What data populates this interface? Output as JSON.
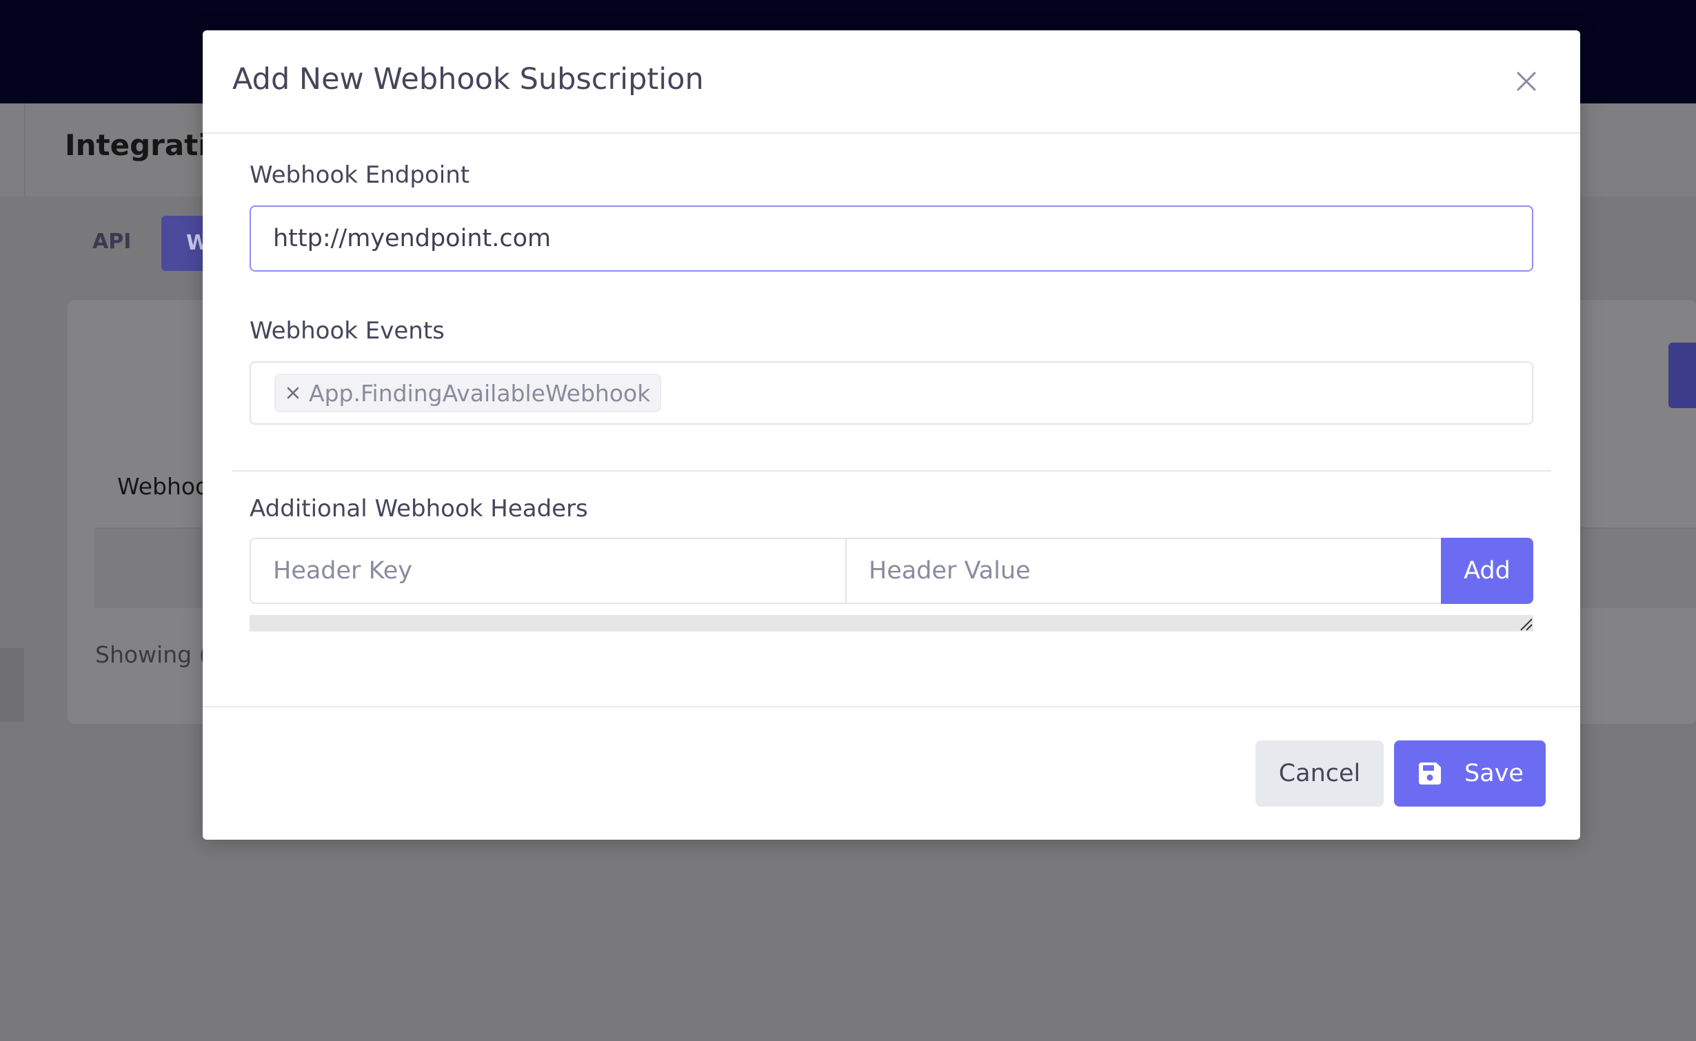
{
  "background": {
    "page_title": "Integratio",
    "tabs": [
      {
        "label": "API"
      },
      {
        "label": "W"
      }
    ],
    "card_label": "Webhoo",
    "showing_text": "Showing ("
  },
  "modal": {
    "title": "Add New Webhook Subscription",
    "close_icon": "close-icon",
    "endpoint": {
      "label": "Webhook Endpoint",
      "value": "http://myendpoint.com"
    },
    "events": {
      "label": "Webhook Events",
      "selected": [
        {
          "label": "App.FindingAvailableWebhook",
          "remove_icon": "close-icon"
        }
      ]
    },
    "headers": {
      "label": "Additional Webhook Headers",
      "key_placeholder": "Header Key",
      "value_placeholder": "Header Value",
      "add_label": "Add"
    },
    "footer": {
      "cancel_label": "Cancel",
      "save_label": "Save",
      "save_icon": "save-icon"
    }
  },
  "colors": {
    "primary": "#6c6cf2",
    "topbar": "#03031e",
    "overlay": "#7b7b7d",
    "text": "#45465a",
    "focus_border": "#8e8ef5"
  }
}
